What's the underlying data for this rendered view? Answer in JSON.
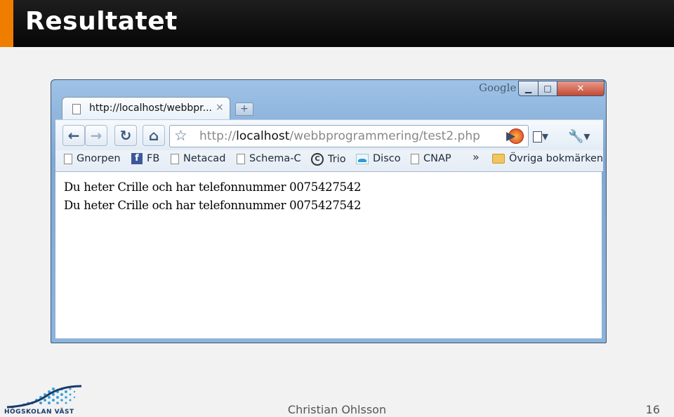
{
  "slide": {
    "title": "Resultatet",
    "author": "Christian Ohlsson",
    "page_number": "16",
    "logo_text": "HÖGSKOLAN VÄST",
    "accent_color": "#ef7d00"
  },
  "browser": {
    "brand": "Google",
    "window_buttons": {
      "minimize": "▁",
      "maximize": "□",
      "close": "✕"
    },
    "tab": {
      "title": "http://localhost/webbpr...",
      "close": "×"
    },
    "new_tab": "+",
    "toolbar": {
      "back": "←",
      "forward": "→",
      "reload": "↻",
      "home": "⌂",
      "bookmark_star": "☆",
      "go": "▶",
      "page_menu": "▾",
      "tools_menu": "▾"
    },
    "address": {
      "scheme": "http://",
      "host": "localhost",
      "path": "/webbprogrammering/test2.php"
    },
    "bookmarks": [
      {
        "label": "Gnorpen",
        "icon": "page-icon"
      },
      {
        "label": "FB",
        "icon": "facebook-icon"
      },
      {
        "label": "Netacad",
        "icon": "page-icon"
      },
      {
        "label": "Schema-C",
        "icon": "page-icon"
      },
      {
        "label": "Trio",
        "icon": "trio-icon"
      },
      {
        "label": "Disco",
        "icon": "disco-icon"
      },
      {
        "label": "CNAP",
        "icon": "page-icon"
      }
    ],
    "bookmarks_more": "»",
    "other_bookmarks": "Övriga bokmärken",
    "content_lines": [
      "Du heter Crille och har telefonnummer 0075427542",
      "Du heter Crille och har telefonnummer 0075427542"
    ]
  }
}
